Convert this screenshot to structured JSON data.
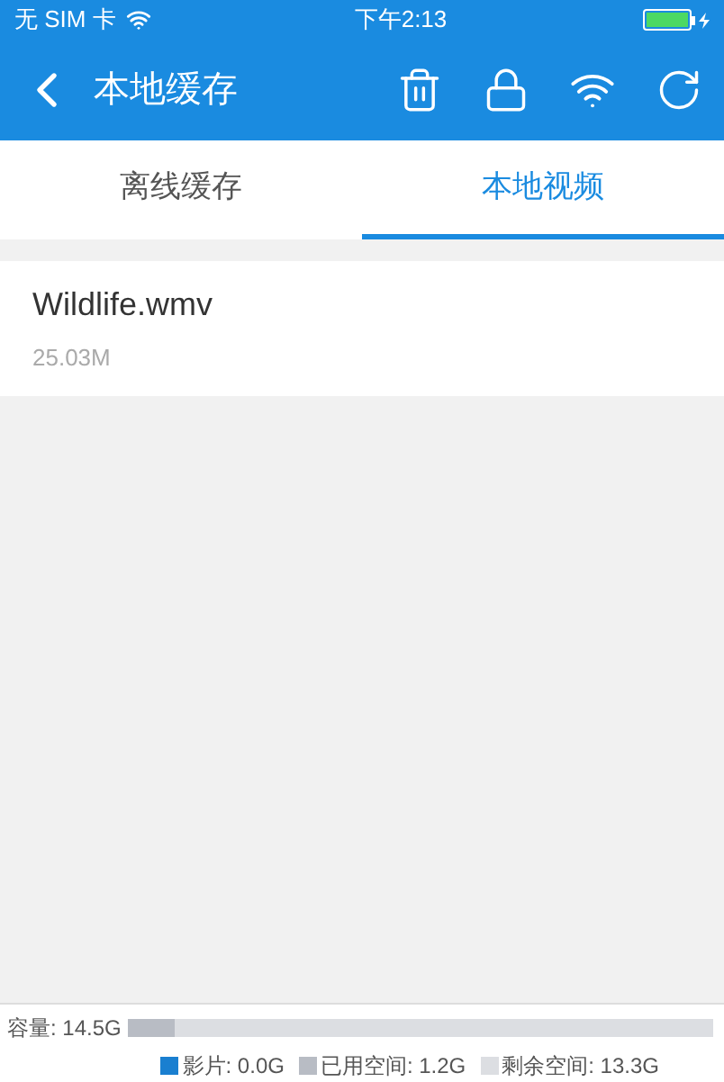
{
  "status_bar": {
    "carrier": "无 SIM 卡",
    "time": "下午2:13"
  },
  "nav": {
    "title": "本地缓存"
  },
  "tabs": [
    {
      "label": "离线缓存",
      "selected": false
    },
    {
      "label": "本地视频",
      "selected": true
    }
  ],
  "files": [
    {
      "name": "Wildlife.wmv",
      "size": "25.03M"
    }
  ],
  "storage": {
    "label": "容量: 14.5G",
    "usage_bar": {
      "level": 0.08
    },
    "legend": [
      {
        "label": "影片: 0.0G",
        "color": "#1a7fd0"
      },
      {
        "label": "已用空间: 1.2G",
        "color": "#b8bcc4"
      },
      {
        "label": "剩余空间: 13.3G",
        "color": "#dcdee2"
      }
    ]
  }
}
